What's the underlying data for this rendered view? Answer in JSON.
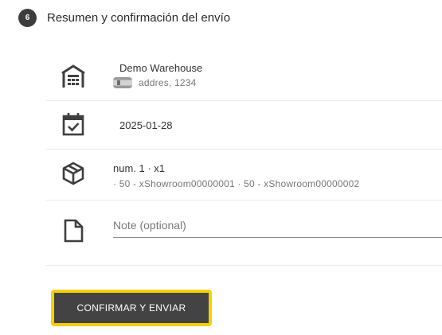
{
  "step": {
    "number": "6",
    "title": "Resumen y confirmación del envío"
  },
  "warehouse": {
    "icon": "warehouse-icon",
    "name": "Demo Warehouse",
    "address": "addres, 1234",
    "flag_icon": "spain-flag-icon"
  },
  "date": {
    "icon": "calendar-check-icon",
    "value": "2025-01-28"
  },
  "package": {
    "icon": "package-icon",
    "title": "num. 1 · x1",
    "detail": "· 50 - xShowroom00000001 · 50 - xShowroom00000002"
  },
  "note": {
    "icon": "document-icon",
    "value": "",
    "placeholder": "Note (optional)"
  },
  "confirm": {
    "label": "CONFIRMAR Y ENVIAR"
  },
  "colors": {
    "badge_bg": "#3c3c3c",
    "button_bg": "#434343",
    "button_outline": "#f5d000",
    "divider": "#e9e9e9"
  }
}
